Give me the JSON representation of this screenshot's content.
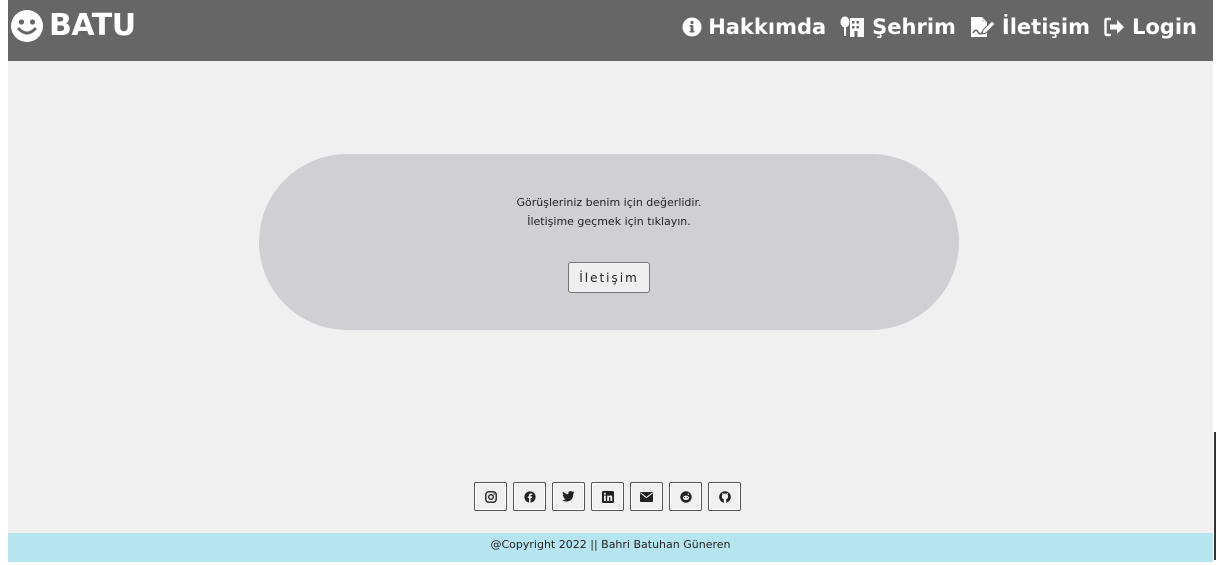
{
  "navbar": {
    "brand_text": "BATU",
    "brand_icon": "smile-icon",
    "links": [
      {
        "label": "Hakkımda",
        "icon": "info-circle-icon"
      },
      {
        "label": "Şehrim",
        "icon": "city-icon"
      },
      {
        "label": "İletişim",
        "icon": "file-signature-icon"
      },
      {
        "label": "Login",
        "icon": "sign-in-icon"
      }
    ]
  },
  "card": {
    "line1": "Görüşleriniz benim için değerlidir.",
    "line2": "İletişime geçmek için tıklayın.",
    "button_label": "İletişim"
  },
  "socials": [
    {
      "name": "instagram",
      "icon": "instagram-icon"
    },
    {
      "name": "facebook",
      "icon": "facebook-icon"
    },
    {
      "name": "twitter",
      "icon": "twitter-icon"
    },
    {
      "name": "linkedin",
      "icon": "linkedin-icon"
    },
    {
      "name": "email",
      "icon": "envelope-icon"
    },
    {
      "name": "reddit",
      "icon": "reddit-icon"
    },
    {
      "name": "github",
      "icon": "github-icon"
    }
  ],
  "footer": {
    "text": "@Copyright 2022 || Bahri Batuhan Güneren"
  },
  "colors": {
    "navbar_bg": "#666666",
    "page_bg": "#f0f0f0",
    "card_bg": "#d0d0d4",
    "footer_bg": "#b6e5f0"
  }
}
